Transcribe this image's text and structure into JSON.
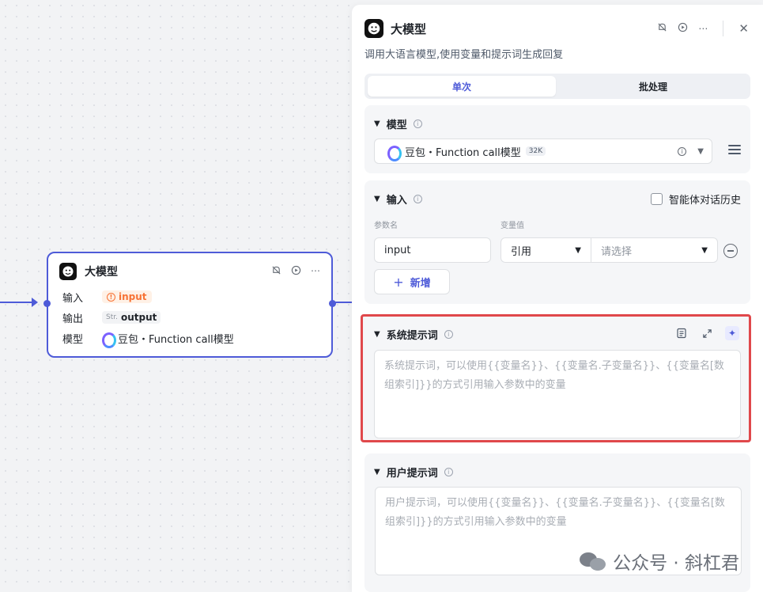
{
  "node": {
    "title": "大模型",
    "rows": {
      "input_label": "输入",
      "input_value": "input",
      "output_label": "输出",
      "output_type": "Str.",
      "output_value": "output",
      "model_label": "模型",
      "model_value": "豆包・Function call模型"
    }
  },
  "panel": {
    "title": "大模型",
    "description": "调用大语言模型,使用变量和提示词生成回复",
    "tabs": [
      {
        "label": "单次",
        "active": true
      },
      {
        "label": "批处理",
        "active": false
      }
    ],
    "model_section": {
      "title": "模型",
      "selected": "豆包・Function call模型",
      "badge": "32K"
    },
    "input_section": {
      "title": "输入",
      "history_label": "智能体对话历史",
      "col_name": "参数名",
      "col_value": "变量值",
      "param_name": "input",
      "ref_type": "引用",
      "value_placeholder": "请选择",
      "add_label": "新增"
    },
    "system_prompt": {
      "title": "系统提示词",
      "placeholder": "系统提示词，可以使用{{变量名}}、{{变量名.子变量名}}、{{变量名[数组索引]}}的方式引用输入参数中的变量"
    },
    "user_prompt": {
      "title": "用户提示词",
      "placeholder": "用户提示词，可以使用{{变量名}}、{{变量名.子变量名}}、{{变量名[数组索引]}}的方式引用输入参数中的变量"
    }
  },
  "watermark": "公众号 · 斜杠君",
  "colors": {
    "accent": "#4e5bd8",
    "highlight_border": "#e0484b",
    "input_tag": "#f77234"
  }
}
